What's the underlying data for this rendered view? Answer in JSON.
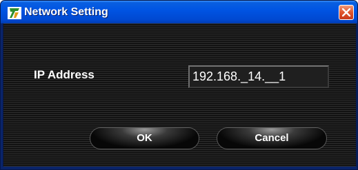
{
  "window": {
    "title": "Network Setting",
    "icon": "app-icon",
    "close_icon": "close-icon",
    "title_bar_color": "#0054e3"
  },
  "form": {
    "ip_label": "IP Address",
    "ip_value": "192.168._14.__1"
  },
  "buttons": {
    "ok_label": "OK",
    "cancel_label": "Cancel"
  }
}
